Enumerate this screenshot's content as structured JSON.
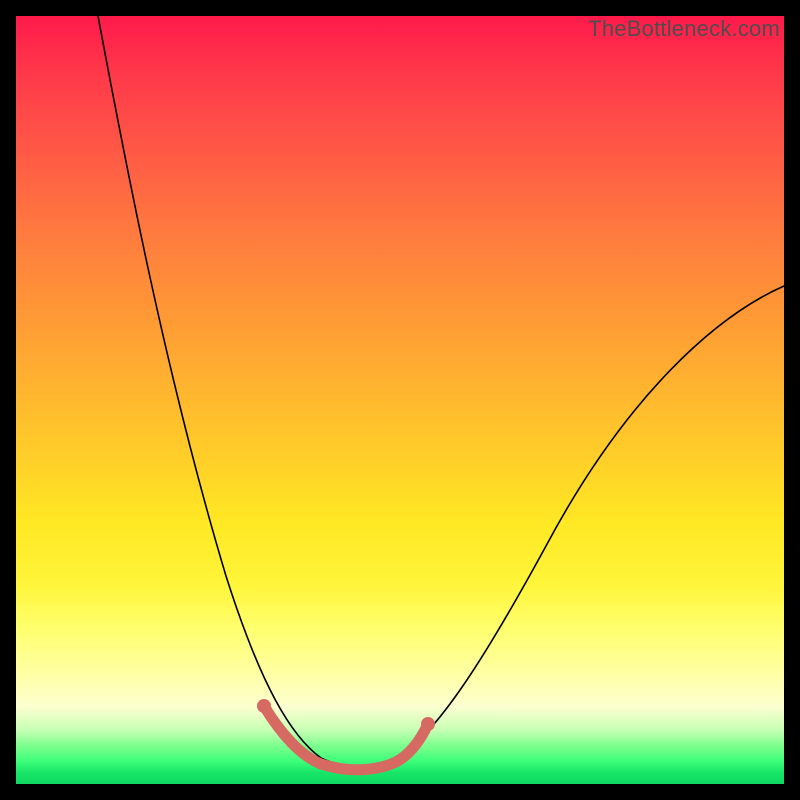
{
  "watermark": "TheBottleneck.com",
  "chart_data": {
    "type": "line",
    "title": "",
    "xlabel": "",
    "ylabel": "",
    "xlim": [
      0,
      100
    ],
    "ylim": [
      0,
      100
    ],
    "grid": false,
    "background_gradient": {
      "direction": "vertical",
      "stops": [
        {
          "pos": 0,
          "color": "#ff1a4b"
        },
        {
          "pos": 28,
          "color": "#ff7a3f"
        },
        {
          "pos": 58,
          "color": "#ffd028"
        },
        {
          "pos": 80,
          "color": "#ffff70"
        },
        {
          "pos": 93,
          "color": "#c6ffb4"
        },
        {
          "pos": 100,
          "color": "#0fd762"
        }
      ]
    },
    "series": [
      {
        "name": "bottleneck-curve",
        "color": "#000000",
        "x": [
          11,
          15,
          20,
          25,
          27,
          30,
          33,
          36,
          39,
          42,
          46,
          50,
          55,
          61,
          69,
          80,
          91,
          100
        ],
        "y": [
          100,
          80,
          58,
          35,
          27,
          15,
          8,
          3,
          2,
          2,
          3,
          6,
          12,
          22,
          31,
          45,
          56,
          65
        ]
      },
      {
        "name": "optimal-range",
        "color": "#d66a63",
        "style": "thick-segment",
        "x": [
          32,
          35,
          38,
          41,
          44,
          47,
          50,
          53
        ],
        "y": [
          10,
          5,
          2,
          2,
          2,
          2,
          4,
          8
        ]
      }
    ],
    "annotations": []
  }
}
